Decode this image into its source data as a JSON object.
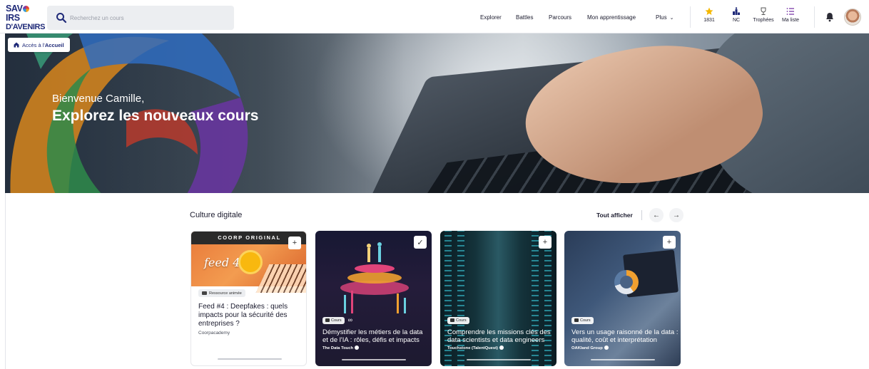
{
  "logo": {
    "line1": "SAV",
    "line1b": "IRS",
    "line2": "D'AVENIRS"
  },
  "search": {
    "placeholder": "Recherchez un cours"
  },
  "nav": {
    "explorer": "Explorer",
    "battles": "Battles",
    "parcours": "Parcours",
    "apprentissage": "Mon apprentissage",
    "plus": "Plus"
  },
  "stats": {
    "stars": "1831",
    "rank": "NC",
    "trophies": "Trophées",
    "mylist": "Ma liste"
  },
  "colors": {
    "brand": "#1f2a78",
    "star": "#f5b800",
    "accent_red": "#e2423b"
  },
  "hero": {
    "access_prefix": "Accès à l'",
    "access_bold": "Accueil",
    "welcome": "Bienvenue Camille,",
    "headline": "Explorez les nouveaux cours"
  },
  "section": {
    "title": "Culture digitale",
    "see_all": "Tout afficher",
    "prev": "←",
    "next": "→"
  },
  "cards": [
    {
      "banner": "COORP ORIGINAL",
      "feed_word": "feed 4",
      "badge": "Ressource animée",
      "title": "Feed #4 : Deepfakes : quels impacts pour la sécurité des entreprises ?",
      "author": "Coorpacademy",
      "action": "+"
    },
    {
      "badge": "Cours",
      "title": "Démystifier les métiers de la data et de l'IA : rôles, défis et impacts",
      "author": "The Data Touch",
      "action": "✓"
    },
    {
      "badge": "Cours",
      "title": "Comprendre les missions clés des data scientists et data engineers",
      "author": "Touchstone (TalentQuest)",
      "action": "+"
    },
    {
      "badge": "Cours",
      "title": "Vers un usage raisonné de la data : qualité, coût et interprétation",
      "author": "OAKland Group",
      "action": "+"
    }
  ]
}
